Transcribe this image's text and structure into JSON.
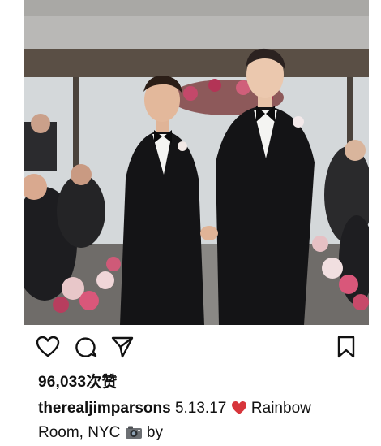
{
  "post": {
    "image_description_label": "wedding-photo",
    "likes_text": "96,033次赞",
    "caption": {
      "username": "therealjimparsons",
      "date": "5.13.17",
      "text_after_heart": "Rainbow",
      "line2_text": "Room, NYC",
      "text_after_camera": "by"
    }
  },
  "icons": {
    "like": "heart-outline-icon",
    "comment": "comment-bubble-icon",
    "share": "paper-plane-icon",
    "save": "bookmark-icon",
    "heart_emoji": "red-heart-emoji-icon",
    "camera_emoji": "camera-emoji-icon"
  },
  "colors": {
    "heart_red": "#d7353b",
    "text": "#111111"
  }
}
